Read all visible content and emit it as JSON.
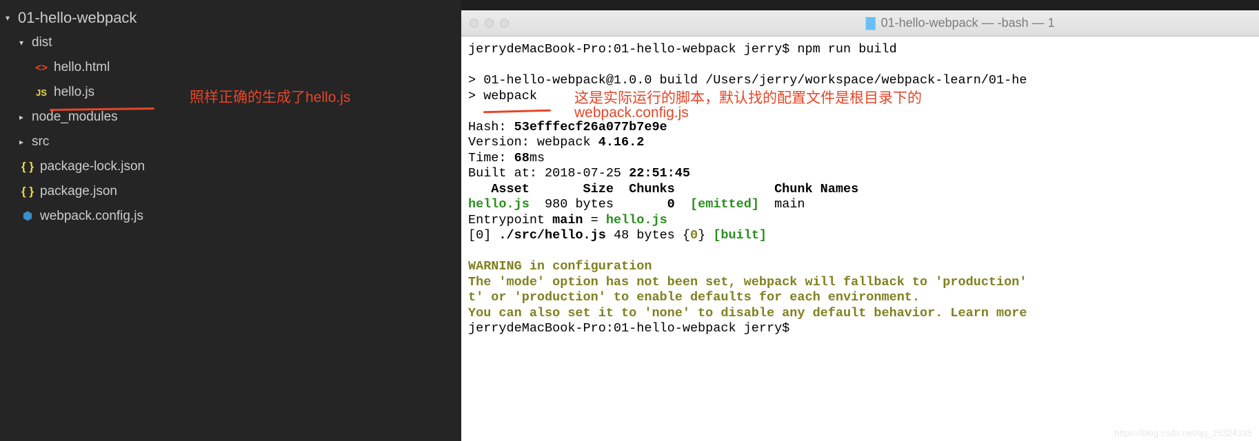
{
  "sidebar": {
    "root": "01-hello-webpack",
    "items": [
      {
        "name": "dist",
        "type": "folder",
        "expanded": true,
        "indent": 1
      },
      {
        "name": "hello.html",
        "type": "html",
        "indent": 2
      },
      {
        "name": "hello.js",
        "type": "js",
        "indent": 2
      },
      {
        "name": "node_modules",
        "type": "folder",
        "expanded": false,
        "indent": 1
      },
      {
        "name": "src",
        "type": "folder",
        "expanded": false,
        "indent": 1
      },
      {
        "name": "package-lock.json",
        "type": "json",
        "indent": 1
      },
      {
        "name": "package.json",
        "type": "json",
        "indent": 1
      },
      {
        "name": "webpack.config.js",
        "type": "webpack",
        "indent": 1
      }
    ]
  },
  "annotations": {
    "a1": "照样正确的生成了hello.js",
    "a2_line1": "这是实际运行的脚本，默认找的配置文件是根目录下的",
    "a2_line2": "webpack.config.js"
  },
  "titlebar": {
    "folder": "01-hello-webpack",
    "suffix": " — -bash — 1"
  },
  "terminal": {
    "prompt1": "jerrydeMacBook-Pro:01-hello-webpack jerry$ npm run build",
    "blank1": "",
    "run1": "> 01-hello-webpack@1.0.0 build /Users/jerry/workspace/webpack-learn/01-he",
    "run2": "> webpack",
    "blank2": "",
    "hash_l": "Hash: ",
    "hash_v": "53efffecf26a077b7e9e",
    "ver_l": "Version: webpack ",
    "ver_v": "4.16.2",
    "time_l": "Time: ",
    "time_v": "68",
    "time_u": "ms",
    "built_l": "Built at: 2018-07-25 ",
    "built_v": "22:51:45",
    "header": "   Asset       Size  Chunks             Chunk Names",
    "row_asset": "hello.js",
    "row_mid": "  980 bytes       ",
    "row_chunk": "0",
    "row_sp": "  ",
    "row_emitted": "[emitted]",
    "row_name": "  main",
    "entry_l": "Entrypoint ",
    "entry_m": "main",
    "entry_eq": " = ",
    "entry_f": "hello.js",
    "mod_a": "[0] ",
    "mod_b": "./src/hello.js",
    "mod_c": " 48 bytes {",
    "mod_d": "0",
    "mod_e": "} ",
    "mod_f": "[built]",
    "blank3": "",
    "warn1": "WARNING in configuration",
    "warn2": "The 'mode' option has not been set, webpack will fallback to 'production' ",
    "warn3": "t' or 'production' to enable defaults for each environment.",
    "warn4": "You can also set it to 'none' to disable any default behavior. Learn more",
    "prompt2": "jerrydeMacBook-Pro:01-hello-webpack jerry$ "
  },
  "watermark": "https://blog.csdn.net/qq_25324335"
}
